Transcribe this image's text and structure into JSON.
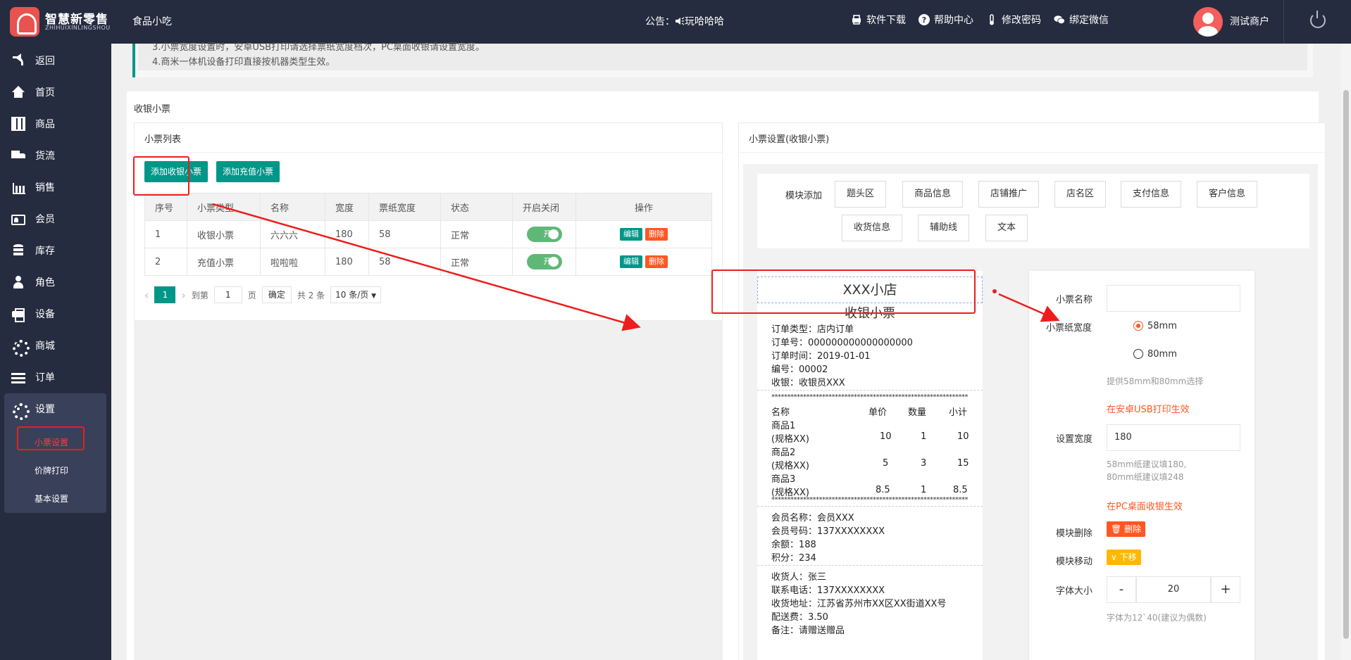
{
  "topbar": {
    "brand_name": "智慧新零售",
    "brand_sub": "ZHIHUIXINLINGSHOU",
    "store_name": "食品小吃",
    "notice_label": "公告：",
    "notice_text": "玩哈哈哈",
    "links": [
      "软件下载",
      "帮助中心",
      "修改密码",
      "绑定微信"
    ],
    "user_name": "测试商户"
  },
  "sidebar": {
    "items": [
      {
        "label": "返回",
        "icon": "back-icon"
      },
      {
        "label": "首页",
        "icon": "home-icon"
      },
      {
        "label": "商品",
        "icon": "grid-icon"
      },
      {
        "label": "货流",
        "icon": "truck-icon"
      },
      {
        "label": "销售",
        "icon": "bar-chart-icon"
      },
      {
        "label": "会员",
        "icon": "id-card-icon"
      },
      {
        "label": "库存",
        "icon": "database-icon"
      },
      {
        "label": "角色",
        "icon": "user-icon"
      },
      {
        "label": "设备",
        "icon": "printer-icon"
      },
      {
        "label": "商城",
        "icon": "gear-icon"
      },
      {
        "label": "订单",
        "icon": "list-icon"
      },
      {
        "label": "设置",
        "icon": "gear-icon"
      }
    ],
    "subitems": [
      "小票设置",
      "价牌打印",
      "基本设置"
    ]
  },
  "notice": {
    "line1": "3.小票宽度设置时，安卓USB打印请选择票纸宽度档次，PC桌面收银请设置宽度。",
    "line2": "4.商米一体机设备打印直接按机器类型生效。"
  },
  "section_title": "收银小票",
  "list": {
    "title": "小票列表",
    "add_receipt": "添加收银小票",
    "add_recharge": "添加充值小票",
    "headers": [
      "序号",
      "小票类型",
      "名称",
      "宽度",
      "票纸宽度",
      "状态",
      "开启关闭",
      "操作"
    ],
    "rows": [
      {
        "no": "1",
        "type": "收银小票",
        "name": "六六六",
        "width": "180",
        "paper": "58",
        "status": "正常",
        "toggle": "开",
        "edit": "编辑",
        "del": "删除"
      },
      {
        "no": "2",
        "type": "充值小票",
        "name": "啦啦啦",
        "width": "180",
        "paper": "58",
        "status": "正常",
        "toggle": "开",
        "edit": "编辑",
        "del": "删除"
      }
    ],
    "pager": {
      "page": "1",
      "goto": "到第",
      "input": "1",
      "page_unit": "页",
      "confirm": "确定",
      "total": "共 2 条",
      "per_page": "10 条/页"
    }
  },
  "settings": {
    "title": "小票设置(收银小票)",
    "module_label": "模块添加",
    "modules": [
      "题头区",
      "商品信息",
      "店铺推广",
      "店名区",
      "支付信息",
      "客户信息",
      "收货信息",
      "辅助线",
      "文本"
    ],
    "receipt": {
      "shop": "XXX小店",
      "subtitle": "收银小票",
      "order_lines": [
        "订单类型：店内订单",
        "订单号：000000000000000000",
        "订单时间：2019-01-01",
        "编号：00002",
        "收银：收银员XXX"
      ],
      "stars": "**************************************************************",
      "item_headers": [
        "名称",
        "单价",
        "数量",
        "小计"
      ],
      "items": [
        {
          "name": "商品1",
          "spec": "(规格XX)",
          "price": "10",
          "qty": "1",
          "sub": "10"
        },
        {
          "name": "商品2",
          "spec": "(规格XX)",
          "price": "5",
          "qty": "3",
          "sub": "15"
        },
        {
          "name": "商品3",
          "spec": "(规格XX)",
          "price": "8.5",
          "qty": "1",
          "sub": "8.5"
        }
      ],
      "member_lines": [
        "会员名称：会员XXX",
        "会员号码：137XXXXXXXX",
        "余额：188",
        "积分：234"
      ],
      "delivery_lines": [
        "收货人：张三",
        "联系电话：137XXXXXXXX",
        "收货地址：江苏省苏州市XX区XX街道XX号",
        "配送费：3.50",
        "备注：请赠送赠品"
      ]
    },
    "props": {
      "name_label": "小票名称",
      "name_value": "",
      "paper_label": "小票纸宽度",
      "opt58": "58mm",
      "opt80": "80mm",
      "paper_note": "提供58mm和80mm选择",
      "usb_note": "在安卓USB打印生效",
      "width_label": "设置宽度",
      "width_value": "180",
      "width_note1": "58mm纸建议填180,",
      "width_note2": "80mm纸建议填248",
      "pc_note": "在PC桌面收银生效",
      "delete_label": "模块删除",
      "delete_btn": "删除",
      "move_label": "模块移动",
      "move_btn": "下移",
      "font_label": "字体大小",
      "font_minus": "-",
      "font_value": "20",
      "font_plus": "+",
      "font_note": "字体为12`40(建议为偶数)"
    }
  },
  "colors": {
    "accent": "#009688",
    "danger": "#ff5722",
    "annotation": "#ee1d1d",
    "topbar": "#252c40"
  }
}
